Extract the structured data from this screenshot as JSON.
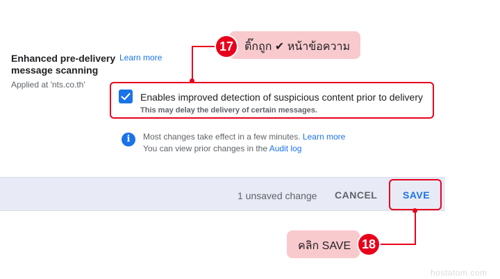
{
  "setting": {
    "title": "Enhanced pre-delivery message scanning",
    "applied_at": "Applied at 'nts.co.th'",
    "learn_more": "Learn more"
  },
  "checkbox": {
    "checked": true,
    "label": "Enables improved detection of suspicious content prior to delivery",
    "hint": "This may delay the delivery of certain messages."
  },
  "info": {
    "line1_text": "Most changes take effect in a few minutes.",
    "line1_link": "Learn more",
    "line2_text": "You can view prior changes in the",
    "line2_link": "Audit log"
  },
  "action_bar": {
    "unsaved": "1 unsaved change",
    "cancel": "CANCEL",
    "save": "SAVE"
  },
  "callouts": [
    {
      "number": "17",
      "text": "ติ๊กถูก ✔ หน้าข้อความ"
    },
    {
      "number": "18",
      "text": "คลิก SAVE"
    }
  ],
  "watermark": "hostatom.com",
  "colors": {
    "accent": "#1a73e8",
    "annotation_red": "#e8001c",
    "callout_bg": "#f9cacd",
    "bar_bg": "#e8eaf6"
  }
}
